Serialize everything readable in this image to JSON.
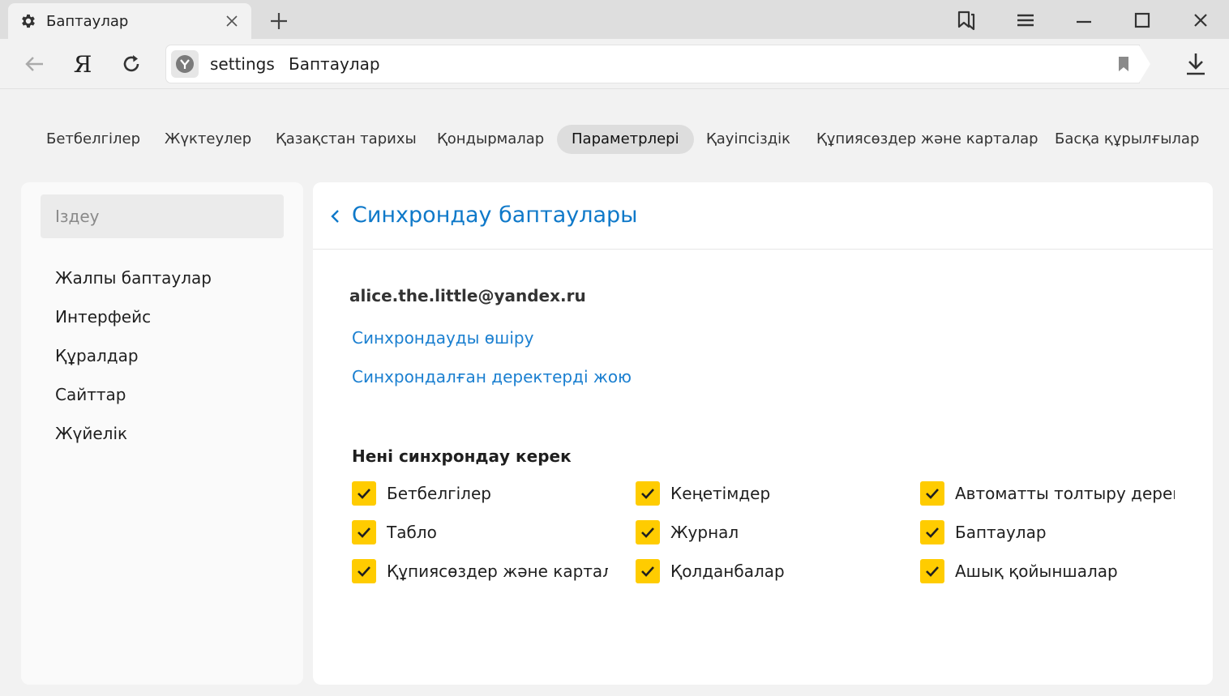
{
  "tab": {
    "title": "Баптаулар"
  },
  "omnibox": {
    "host": "settings",
    "page_title": "Баптаулар"
  },
  "settings_nav": {
    "items": [
      {
        "label": "Бетбелгілер",
        "active": false
      },
      {
        "label": "Жүктеулер",
        "active": false
      },
      {
        "label": "Қазақстан тарихы",
        "active": false
      },
      {
        "label": "Қондырмалар",
        "active": false
      },
      {
        "label": "Параметрлері",
        "active": true
      },
      {
        "label": "Қауіпсіздік",
        "active": false
      },
      {
        "label": "Құпиясөздер және карталар",
        "active": false
      },
      {
        "label": "Басқа құрылғылар",
        "active": false
      }
    ]
  },
  "sidebar": {
    "search_placeholder": "Іздеу",
    "items": [
      {
        "label": "Жалпы баптаулар"
      },
      {
        "label": "Интерфейс"
      },
      {
        "label": "Құралдар"
      },
      {
        "label": "Сайттар"
      },
      {
        "label": "Жүйелік"
      }
    ]
  },
  "main": {
    "title": "Синхрондау баптаулары",
    "account_email": "alice.the.little@yandex.ru",
    "disable_sync_link": "Синхрондауды өшіру",
    "delete_synced_link": "Синхрондалған деректерді жою",
    "sync_section_title": "Нені синхрондау керек",
    "sync_items": [
      {
        "label": "Бетбелгілер",
        "checked": true
      },
      {
        "label": "Кеңетімдер",
        "checked": true
      },
      {
        "label": "Автоматты толтыру деректері",
        "checked": true
      },
      {
        "label": "Табло",
        "checked": true
      },
      {
        "label": "Журнал",
        "checked": true
      },
      {
        "label": "Баптаулар",
        "checked": true
      },
      {
        "label": "Құпиясөздер және карталар",
        "checked": true
      },
      {
        "label": "Қолданбалар",
        "checked": true
      },
      {
        "label": "Ашық қойыншалар",
        "checked": true
      }
    ]
  },
  "colors": {
    "accent_link": "#1a7fd0",
    "title_blue": "#0f79c9",
    "checkbox_yellow": "#ffcc00"
  },
  "icons": {
    "tab": "gear-icon",
    "tab_close": "close-icon",
    "new_tab": "plus-icon",
    "window": [
      "bookmarks-panel-icon",
      "menu-icon",
      "minimize-icon",
      "maximize-icon",
      "close-window-icon"
    ],
    "toolbar": [
      "back-arrow-icon",
      "yandex-logo-icon",
      "reload-icon",
      "protect-shield-icon",
      "bookmark-icon",
      "download-icon"
    ],
    "back": "chevron-left-icon",
    "check": "checkmark-icon"
  }
}
